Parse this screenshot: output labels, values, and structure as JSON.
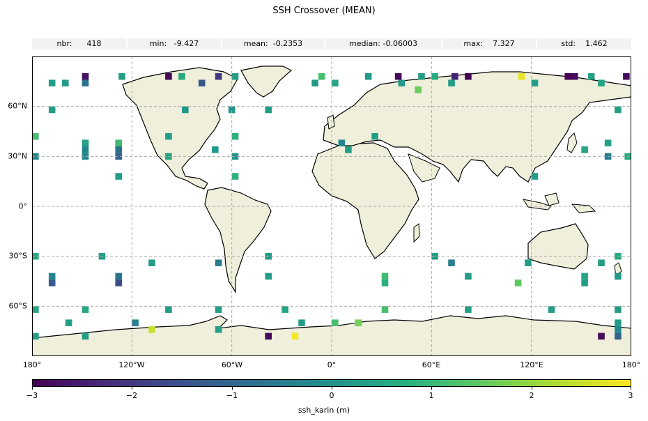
{
  "title": "SSH Crossover (MEAN)",
  "stats": [
    {
      "label": "nbr:",
      "value": "418"
    },
    {
      "label": "min:",
      "value": "-9.427"
    },
    {
      "label": "mean:",
      "value": "-0.2353"
    },
    {
      "label": "median:",
      "value": "-0.06003"
    },
    {
      "label": "max:",
      "value": "7.327"
    },
    {
      "label": "std:",
      "value": "1.462"
    }
  ],
  "map": {
    "projection": "PlateCarree",
    "lon_range": [
      -180,
      180
    ],
    "lat_range": [
      -90,
      90
    ],
    "land_color": "#efefdb",
    "ocean_color": "#ffffff",
    "gridline_color": "#aaaaaa",
    "x_ticks": [
      "180°",
      "120°W",
      "60°W",
      "0°",
      "60°E",
      "120°E",
      "180°"
    ],
    "y_ticks": [
      "60°N",
      "30°N",
      "0°",
      "30°S",
      "60°S"
    ]
  },
  "colorbar": {
    "label": "ssh_karin (m)",
    "range": [
      -3,
      3
    ],
    "ticks": [
      "−3",
      "−2",
      "−1",
      "0",
      "1",
      "2",
      "3"
    ],
    "colormap": "viridis"
  },
  "chart_data": {
    "type": "heatmap",
    "title": "SSH Crossover (MEAN)",
    "xlabel": "",
    "ylabel": "",
    "cell_size_deg": [
      4,
      4
    ],
    "value_units": "m",
    "clim": [
      -3,
      3
    ],
    "cells": [
      [
        76,
        80,
        80,
        -3
      ],
      [
        76,
        80,
        72,
        -2.4
      ],
      [
        76,
        80,
        60,
        0.7
      ],
      [
        76,
        80,
        52,
        0.3
      ],
      [
        76,
        80,
        20,
        0.2
      ],
      [
        76,
        80,
        -8,
        1.2
      ],
      [
        76,
        80,
        -60,
        0.3
      ],
      [
        76,
        80,
        -70,
        -2
      ],
      [
        76,
        80,
        -92,
        0.6
      ],
      [
        76,
        80,
        -150,
        -2.7
      ],
      [
        76,
        80,
        -100,
        -2.9
      ],
      [
        76,
        80,
        140,
        -3
      ],
      [
        76,
        80,
        144,
        -2.8
      ],
      [
        76,
        80,
        154,
        0.4
      ],
      [
        76,
        80,
        175,
        -2.8
      ],
      [
        76,
        80,
        38,
        -2.9
      ],
      [
        76,
        80,
        -128,
        0.3
      ],
      [
        76,
        80,
        112,
        2.8
      ],
      [
        72,
        76,
        -170,
        0.3
      ],
      [
        72,
        76,
        -162,
        0.3
      ],
      [
        72,
        76,
        -150,
        -0.8
      ],
      [
        72,
        76,
        -80,
        -1.4
      ],
      [
        72,
        76,
        -12,
        0.2
      ],
      [
        72,
        76,
        0,
        0.5
      ],
      [
        72,
        76,
        40,
        0.2
      ],
      [
        72,
        76,
        70,
        0.3
      ],
      [
        72,
        76,
        120,
        0.3
      ],
      [
        72,
        76,
        160,
        0.5
      ],
      [
        68,
        72,
        50,
        1.6
      ],
      [
        56,
        60,
        -170,
        0.3
      ],
      [
        56,
        60,
        -90,
        0.2
      ],
      [
        56,
        60,
        -62,
        0.1
      ],
      [
        56,
        60,
        -40,
        0.3
      ],
      [
        56,
        60,
        170,
        0.3
      ],
      [
        40,
        44,
        -180,
        1.2
      ],
      [
        40,
        44,
        -100,
        0.3
      ],
      [
        40,
        44,
        -60,
        0.8
      ],
      [
        40,
        44,
        24,
        0.3
      ],
      [
        36,
        40,
        -150,
        0.4
      ],
      [
        36,
        40,
        -130,
        1.1
      ],
      [
        36,
        40,
        4,
        -0.3
      ],
      [
        36,
        40,
        164,
        0.4
      ],
      [
        32,
        36,
        -150,
        -0.3
      ],
      [
        32,
        36,
        -130,
        -0.7
      ],
      [
        32,
        36,
        -72,
        0.2
      ],
      [
        32,
        36,
        8,
        0.3
      ],
      [
        32,
        36,
        150,
        0.5
      ],
      [
        28,
        32,
        -180,
        -0.2
      ],
      [
        28,
        32,
        -150,
        -0.3
      ],
      [
        28,
        32,
        -130,
        -1.1
      ],
      [
        28,
        32,
        -100,
        0.5
      ],
      [
        28,
        32,
        -60,
        0.1
      ],
      [
        28,
        32,
        164,
        -0.5
      ],
      [
        28,
        32,
        176,
        0.7
      ],
      [
        16,
        20,
        -130,
        0.3
      ],
      [
        16,
        20,
        -60,
        0.8
      ],
      [
        16,
        20,
        120,
        0.3
      ],
      [
        -32,
        -28,
        -180,
        0.6
      ],
      [
        -32,
        -28,
        -140,
        0.3
      ],
      [
        -32,
        -28,
        -40,
        0.3
      ],
      [
        -32,
        -28,
        60,
        0.3
      ],
      [
        -32,
        -28,
        170,
        0.6
      ],
      [
        -36,
        -32,
        -110,
        0.3
      ],
      [
        -36,
        -32,
        -70,
        -0.5
      ],
      [
        -36,
        -32,
        70,
        -0.4
      ],
      [
        -36,
        -32,
        116,
        0.3
      ],
      [
        -36,
        -32,
        160,
        0.3
      ],
      [
        -44,
        -40,
        -170,
        -0.3
      ],
      [
        -44,
        -40,
        -130,
        -0.7
      ],
      [
        -44,
        -40,
        -40,
        0.3
      ],
      [
        -44,
        -40,
        30,
        1.1
      ],
      [
        -44,
        -40,
        80,
        0.3
      ],
      [
        -44,
        -40,
        150,
        0.5
      ],
      [
        -44,
        -40,
        170,
        0.2
      ],
      [
        -48,
        -44,
        -170,
        -1.3
      ],
      [
        -48,
        -44,
        -130,
        -1.6
      ],
      [
        -48,
        -44,
        30,
        0.8
      ],
      [
        -48,
        -44,
        110,
        1.5
      ],
      [
        -48,
        -44,
        150,
        0.3
      ],
      [
        -64,
        -60,
        -180,
        0.5
      ],
      [
        -64,
        -60,
        -150,
        0.6
      ],
      [
        -64,
        -60,
        -100,
        0.3
      ],
      [
        -64,
        -60,
        -70,
        0.3
      ],
      [
        -64,
        -60,
        -30,
        0.5
      ],
      [
        -64,
        -60,
        30,
        1.2
      ],
      [
        -64,
        -60,
        80,
        0.4
      ],
      [
        -64,
        -60,
        130,
        0.3
      ],
      [
        -64,
        -60,
        170,
        0.3
      ],
      [
        -72,
        -68,
        -160,
        0.3
      ],
      [
        -72,
        -68,
        -120,
        -0.4
      ],
      [
        -72,
        -68,
        -20,
        0.3
      ],
      [
        -72,
        -68,
        0,
        1.2
      ],
      [
        -72,
        -68,
        14,
        1.7
      ],
      [
        -72,
        -68,
        170,
        0.3
      ],
      [
        -76,
        -72,
        -110,
        2.5
      ],
      [
        -76,
        -72,
        -70,
        0.4
      ],
      [
        -76,
        -72,
        170,
        -0.2
      ],
      [
        -80,
        -76,
        -180,
        0.4
      ],
      [
        -80,
        -76,
        -150,
        0.3
      ],
      [
        -80,
        -76,
        -40,
        -2.9
      ],
      [
        -80,
        -76,
        -24,
        2.9
      ],
      [
        -80,
        -76,
        160,
        -2.8
      ],
      [
        -80,
        -76,
        170,
        -1.1
      ]
    ]
  }
}
